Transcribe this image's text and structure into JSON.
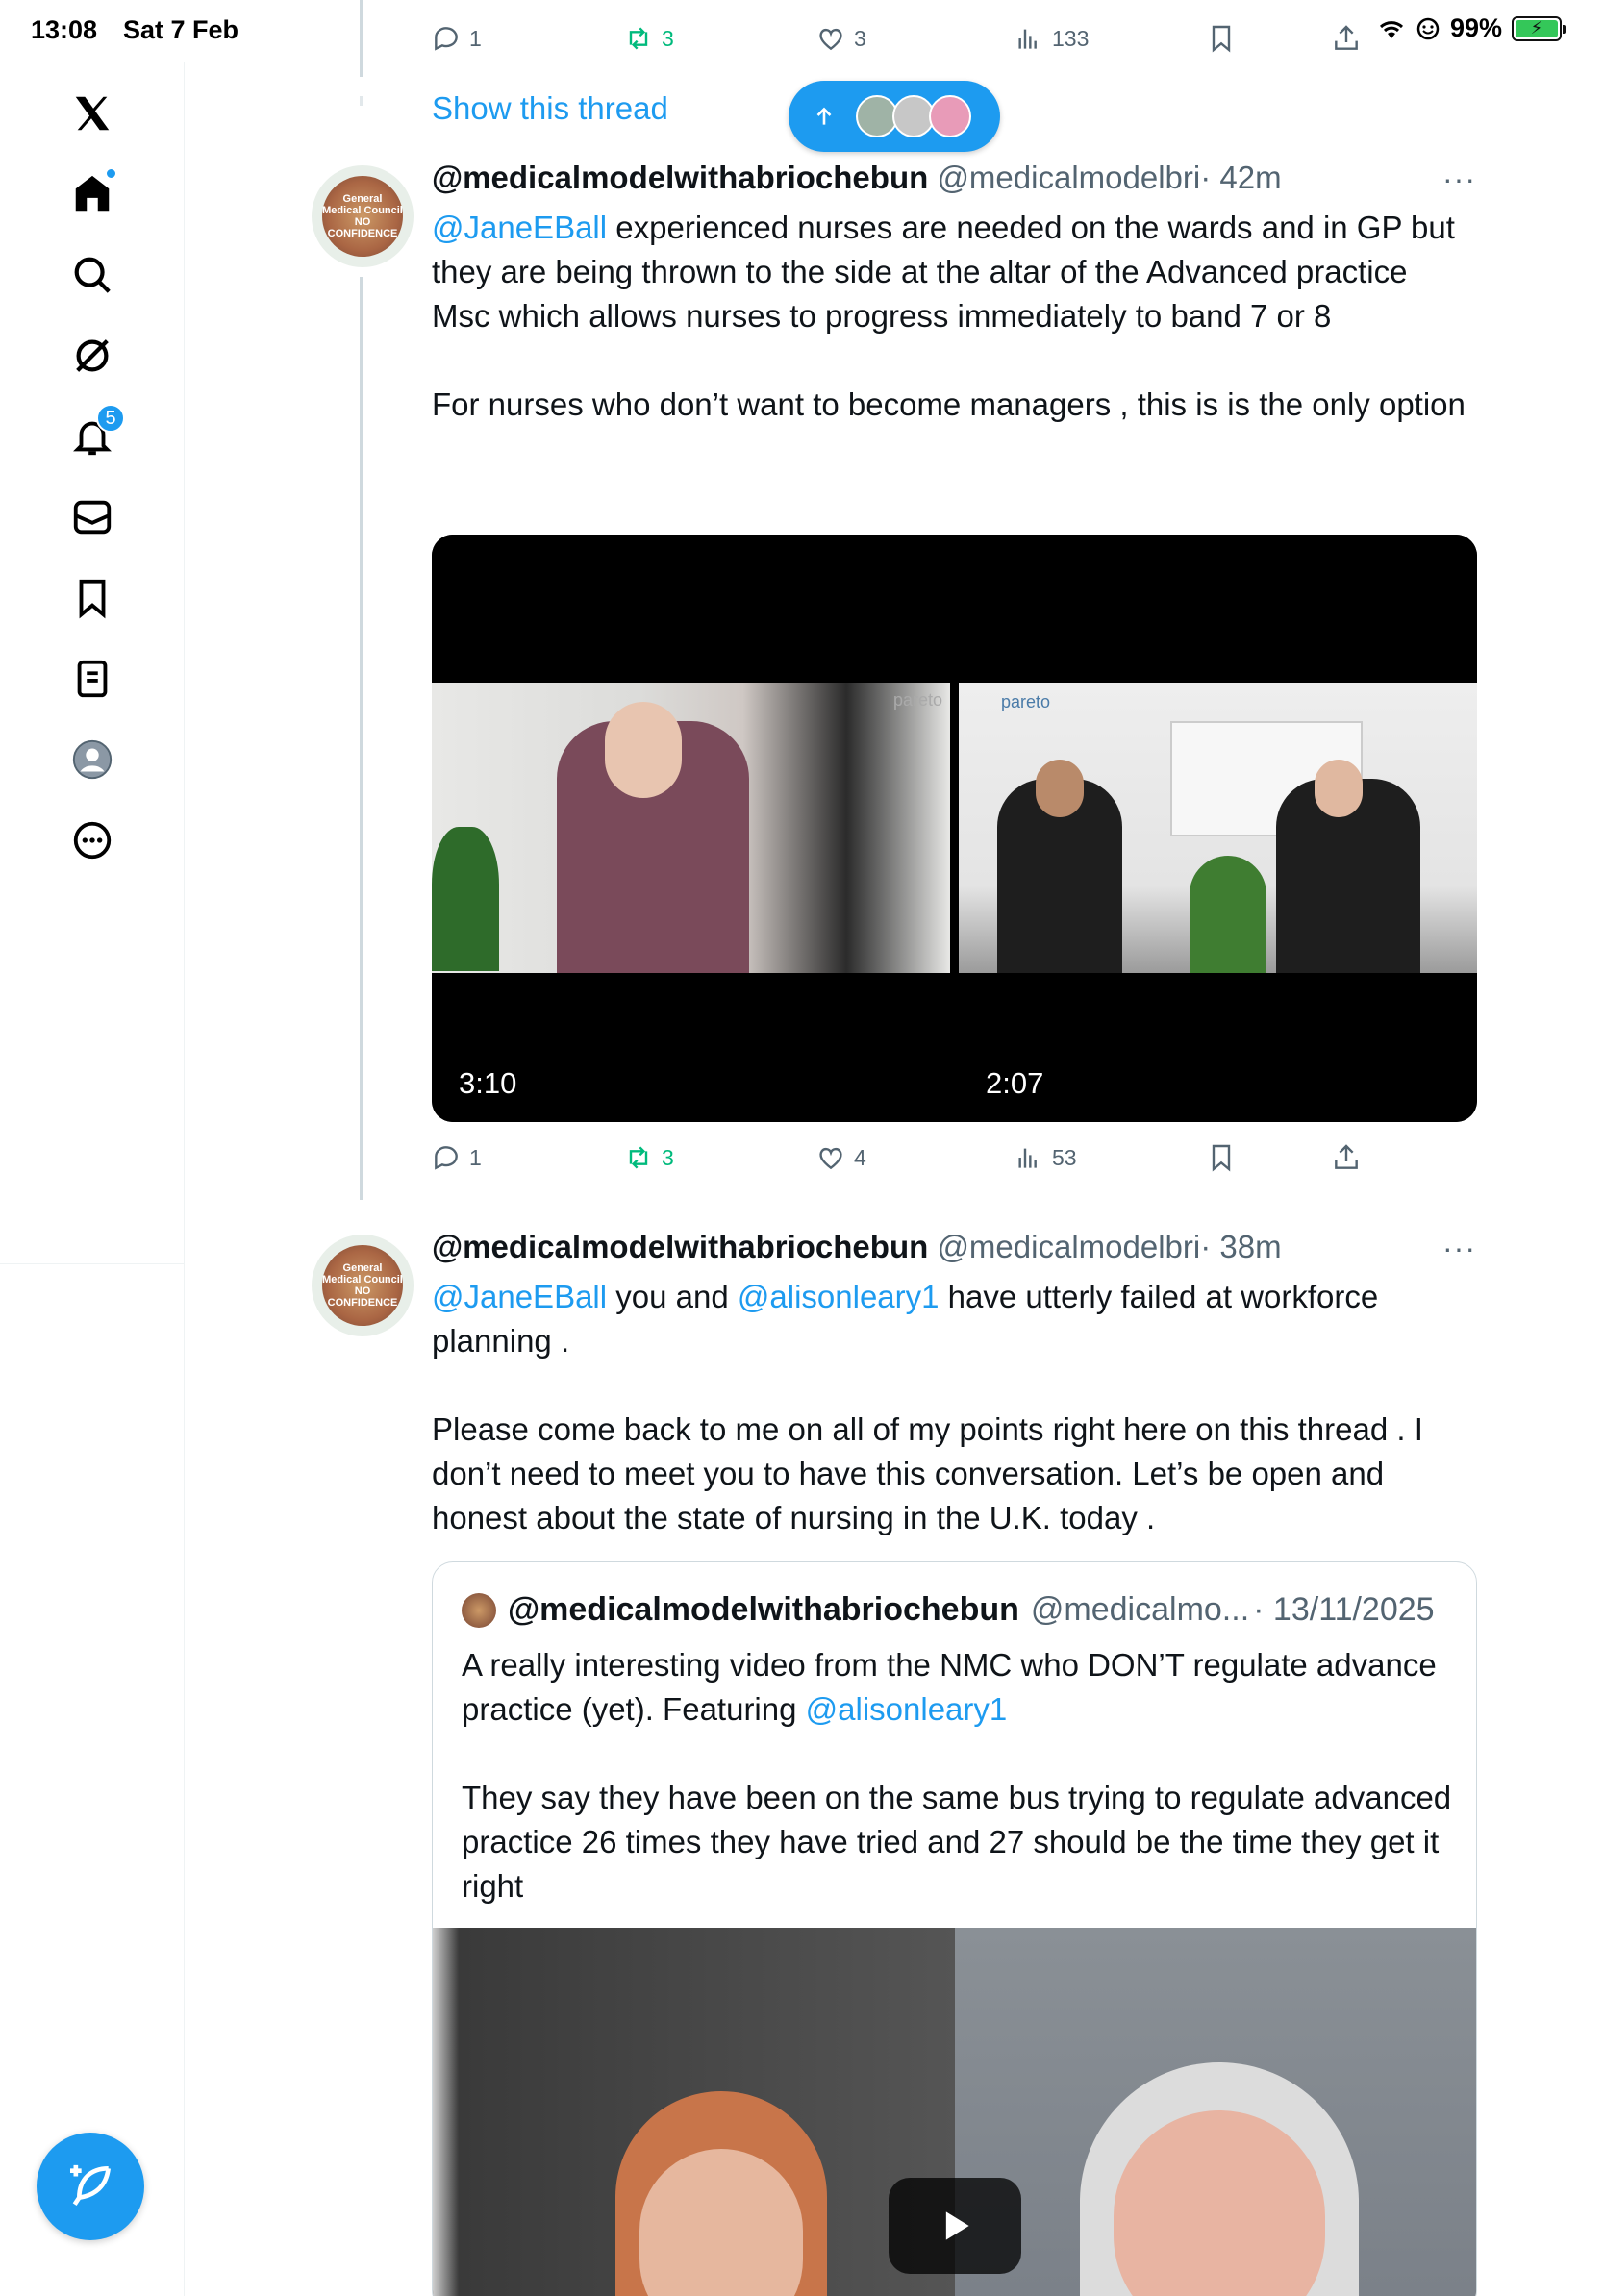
{
  "status_bar": {
    "time": "13:08",
    "date": "Sat 7 Feb",
    "battery": "99%"
  },
  "sidebar": {
    "notifications_badge": "5"
  },
  "top_actions": {
    "replies": "1",
    "reposts": "3",
    "likes": "3",
    "views": "133"
  },
  "show_thread": "Show this thread",
  "tweet1": {
    "display_name": "@medicalmodelwithabriochebun",
    "handle": "@medicalmodelbri",
    "time": "· 42m",
    "more": "···",
    "mention": "@JaneEBall",
    "text_after_mention": " experienced nurses are needed on the wards and in GP but they are being thrown to the side at the altar of the Advanced practice Msc which allows nurses to progress immediately to band 7 or 8\n\nFor nurses who don’t want to become managers , this is is the only option",
    "video1_duration": "3:10",
    "video2_duration": "2:07",
    "video_brand": "pareto",
    "actions": {
      "replies": "1",
      "reposts": "3",
      "likes": "4",
      "views": "53"
    }
  },
  "tweet2": {
    "display_name": "@medicalmodelwithabriochebun",
    "handle": "@medicalmodelbri",
    "time": "· 38m",
    "more": "···",
    "mention1": "@JaneEBall",
    "text_mid": " you and ",
    "mention2": "@alisonleary1",
    "text_after": " have utterly failed at workforce planning .\n\nPlease come back to me on all of my points right here on this thread . I don’t need to meet you to have this conversation. Let’s be open and honest about the state of nursing in the U.K. today .",
    "quote": {
      "display_name": "@medicalmodelwithabriochebun",
      "handle": "@medicalmo...",
      "date": "· 13/11/2025",
      "text_before": "A really interesting video from the NMC who DON’T regulate advance practice (yet). Featuring ",
      "mention": "@alisonleary1",
      "text_after": "\n\nThey say they have been on the same bus trying to regulate advanced practice 26 times they have tried and 27 should be the time they get it right"
    }
  },
  "avatar_text": "General Medical Council NO CONFIDENCE",
  "colors": {
    "accent": "#1d9bf0",
    "repost_green": "#00ba7c",
    "muted": "#536471"
  }
}
